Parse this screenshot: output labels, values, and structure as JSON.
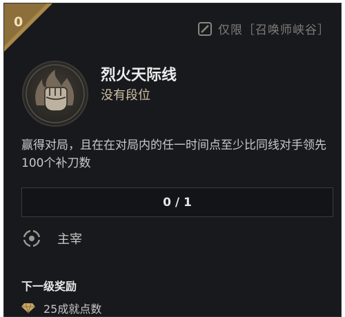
{
  "corner": {
    "level": "0"
  },
  "tag": {
    "icon": "slash-square-icon",
    "text": "仅限［召唤师峡谷］"
  },
  "challenge": {
    "emblem_icon": "fist-flame-emblem-icon",
    "title": "烈火天际线",
    "rank": "没有段位",
    "description": "赢得对局，且在在对局内的任一时间点至少比同线对手领先100个补刀数"
  },
  "progress": {
    "current": 0,
    "total": 1,
    "text": "0 / 1",
    "fraction": 0
  },
  "role": {
    "icon": "dominance-target-icon",
    "label": "主宰"
  },
  "reward": {
    "heading": "下一级奖励",
    "icon": "diamond-gem-icon",
    "text": "25成就点数"
  },
  "colors": {
    "background": "#18191d",
    "gold": "#c8a867",
    "text": "#c9c9c9"
  }
}
